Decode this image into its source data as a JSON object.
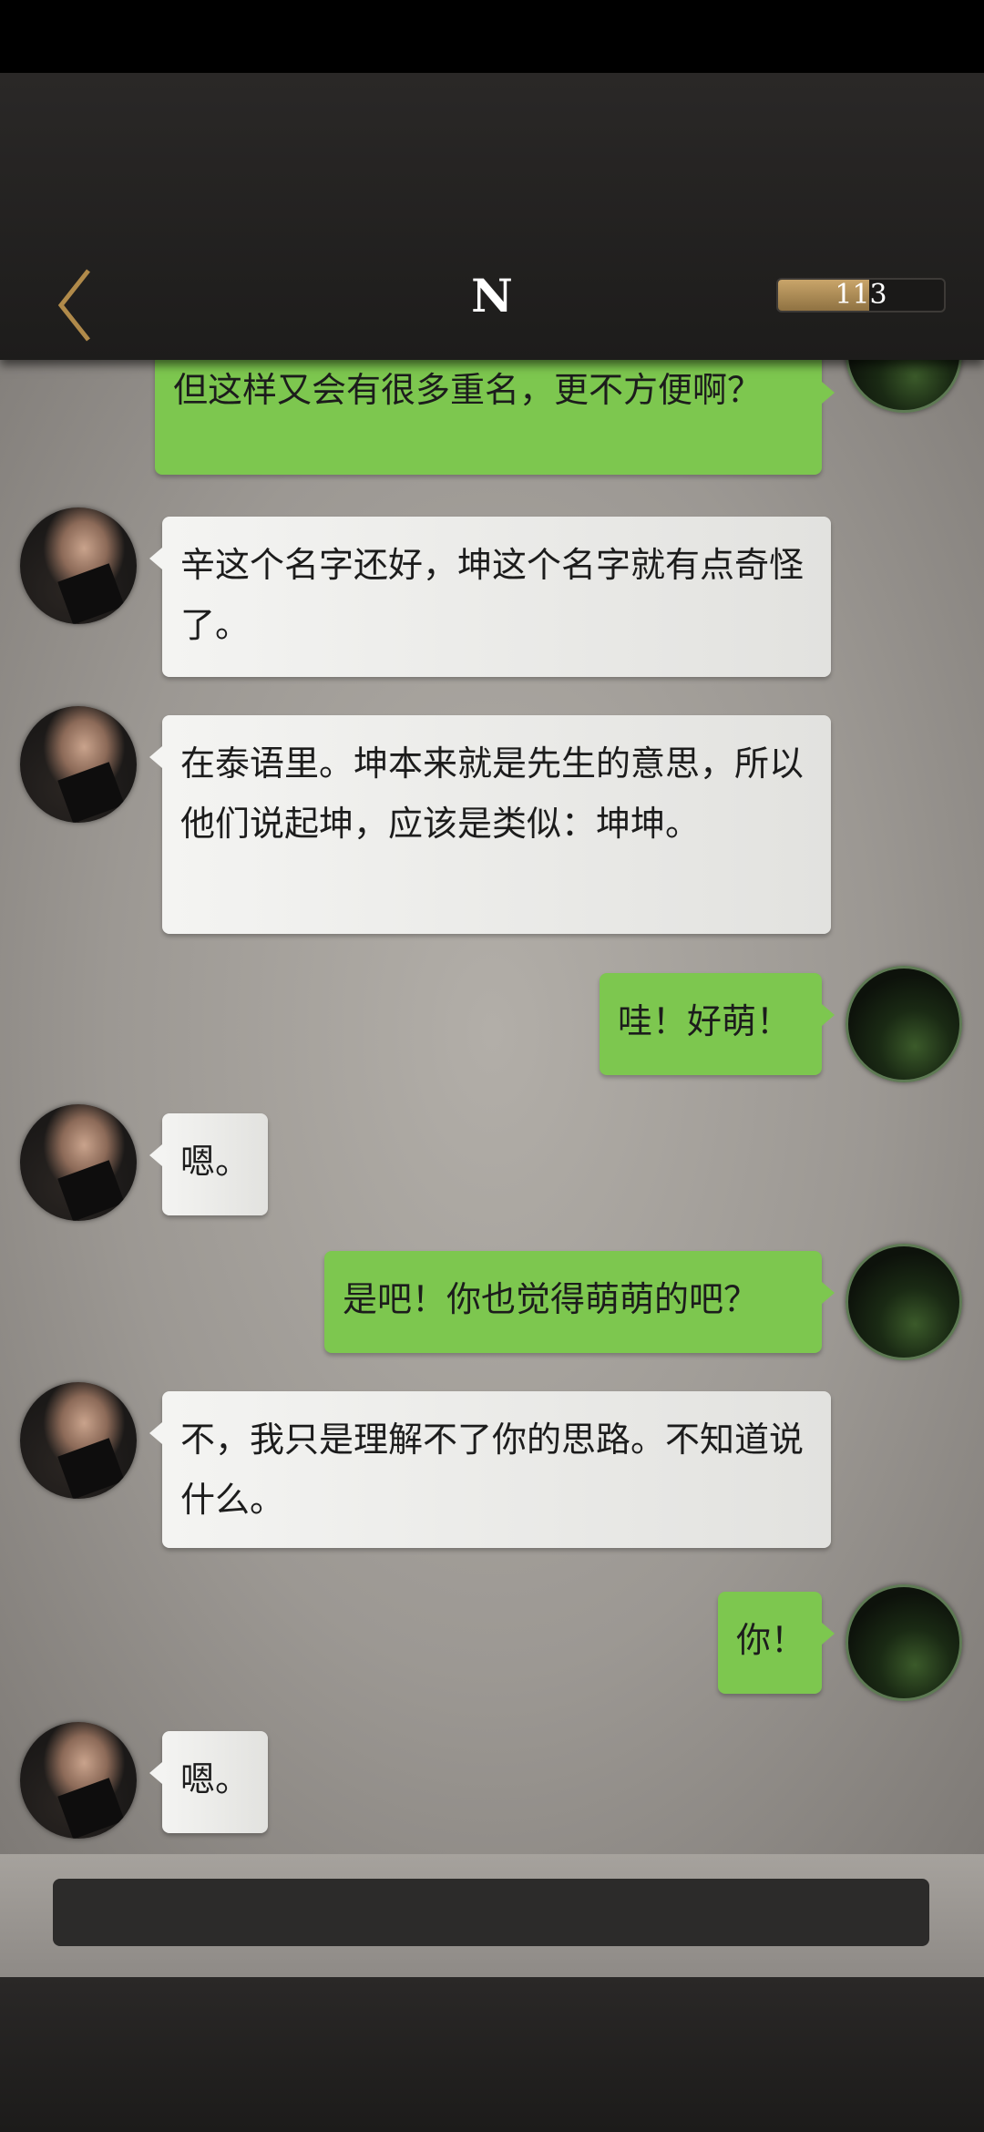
{
  "header": {
    "title": "N",
    "back_icon": "chevron-left-icon",
    "score": {
      "value": "113",
      "fill_fraction": 0.55
    }
  },
  "messages": [
    {
      "side": "right",
      "text": "但这样又会有很多重名，更不方便啊？"
    },
    {
      "side": "left",
      "text": "辛这个名字还好，坤这个名字就有点奇怪了。"
    },
    {
      "side": "left",
      "text": "在泰语里。坤本来就是先生的意思，所以他们说起坤，应该是类似：坤坤。"
    },
    {
      "side": "right",
      "text": "哇！好萌！"
    },
    {
      "side": "left",
      "text": "嗯。"
    },
    {
      "side": "right",
      "text": "是吧！你也觉得萌萌的吧？"
    },
    {
      "side": "left",
      "text": "不，我只是理解不了你的思路。不知道说什么。"
    },
    {
      "side": "right",
      "text": "你！"
    },
    {
      "side": "left",
      "text": "嗯。"
    }
  ],
  "colors": {
    "user_bubble": "#7dc74f",
    "npc_bubble": "#f0f0ee",
    "header_bg": "#242221",
    "back_icon": "#b08a4a"
  }
}
